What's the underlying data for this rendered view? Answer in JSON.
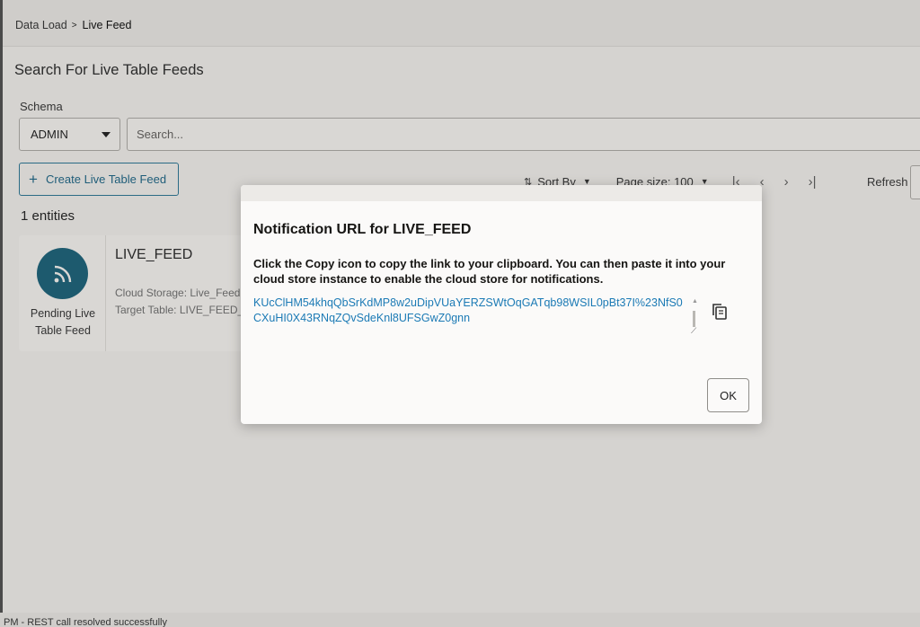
{
  "breadcrumb": {
    "parent": "Data Load",
    "separator": ">",
    "current": "Live Feed"
  },
  "page": {
    "title": "Search For Live Table Feeds"
  },
  "schema": {
    "label": "Schema",
    "selected": "ADMIN"
  },
  "search": {
    "placeholder": "Search..."
  },
  "create_button": {
    "label": "Create Live Table Feed"
  },
  "toolbar": {
    "sort_label": "Sort By",
    "page_size_label": "Page size: 100",
    "refresh_label": "Refresh"
  },
  "results": {
    "count_text": "1 entities"
  },
  "card": {
    "title": "LIVE_FEED",
    "status": "Pending Live Table Feed",
    "cloud_storage": "Cloud Storage: Live_Feed",
    "target_table": "Target Table: LIVE_FEED_"
  },
  "modal": {
    "title": "Notification URL for LIVE_FEED",
    "message": "Click the Copy icon to copy the link to your clipboard. You can then paste it into your cloud store instance to enable the cloud store for notifications.",
    "url": "KUcClHM54khqQbSrKdMP8w2uDipVUaYERZSWtOqGATqb98WSIL0pBt37I%23NfS0CXuHI0X43RNqZQvSdeKnl8UFSGwZ0gnn",
    "ok_label": "OK"
  },
  "statusbar": {
    "text": "PM - REST call resolved successfully"
  },
  "colors": {
    "accent": "#1d5a6e",
    "link": "#1b7ab5"
  }
}
